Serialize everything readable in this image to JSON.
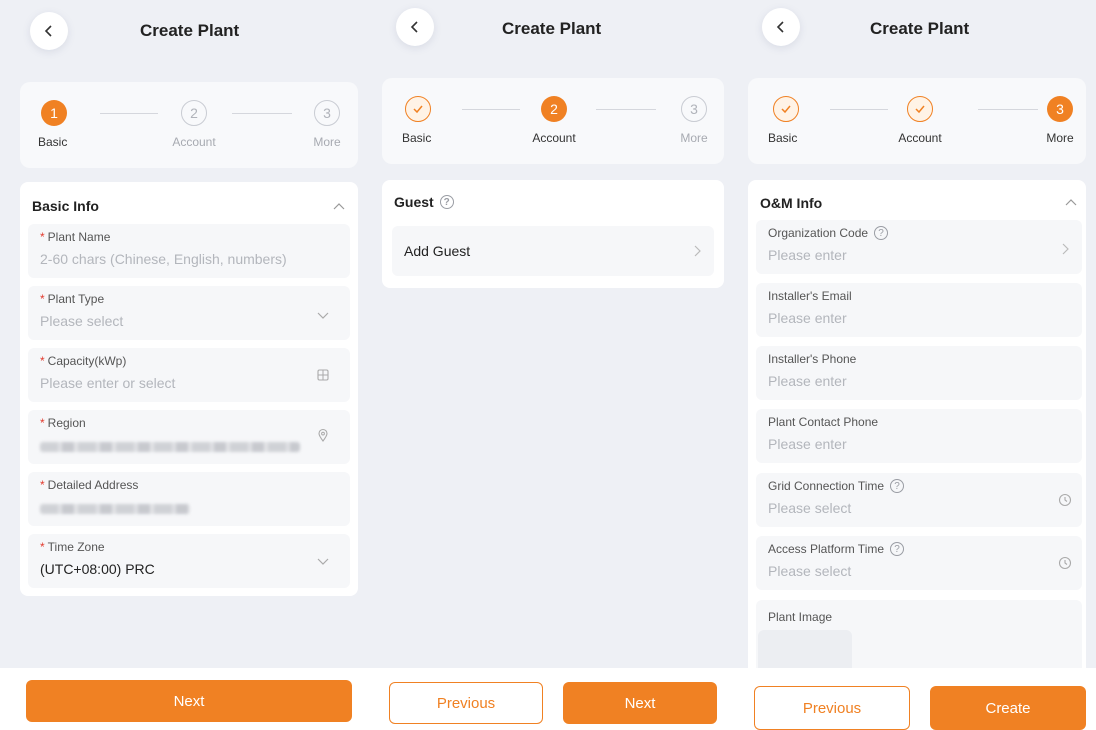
{
  "colors": {
    "accent": "#f08123",
    "background": "#eef0f5",
    "card": "#ffffff",
    "required": "#e23b2e"
  },
  "screen1": {
    "title": "Create Plant",
    "steps": [
      {
        "num": "1",
        "label": "Basic",
        "state": "active"
      },
      {
        "num": "2",
        "label": "Account",
        "state": "pending"
      },
      {
        "num": "3",
        "label": "More",
        "state": "pending"
      }
    ],
    "section_title": "Basic Info",
    "fields": {
      "plant_name": {
        "label": "Plant Name",
        "placeholder": "2-60 chars (Chinese, English, numbers)"
      },
      "plant_type": {
        "label": "Plant Type",
        "placeholder": "Please select"
      },
      "capacity": {
        "label": "Capacity(kWp)",
        "placeholder": "Please enter or select"
      },
      "region": {
        "label": "Region"
      },
      "address": {
        "label": "Detailed Address"
      },
      "timezone": {
        "label": "Time Zone",
        "value": "(UTC+08:00) PRC"
      }
    },
    "required_mark": "*",
    "next_label": "Next"
  },
  "screen2": {
    "title": "Create Plant",
    "steps": [
      {
        "num": "",
        "label": "Basic",
        "state": "done"
      },
      {
        "num": "2",
        "label": "Account",
        "state": "active"
      },
      {
        "num": "3",
        "label": "More",
        "state": "pending"
      }
    ],
    "guest_title": "Guest",
    "add_guest_label": "Add Guest",
    "previous_label": "Previous",
    "next_label": "Next"
  },
  "screen3": {
    "title": "Create Plant",
    "steps": [
      {
        "num": "",
        "label": "Basic",
        "state": "done"
      },
      {
        "num": "",
        "label": "Account",
        "state": "done"
      },
      {
        "num": "3",
        "label": "More",
        "state": "active"
      }
    ],
    "section_title": "O&M Info",
    "fields": {
      "org_code": {
        "label": "Organization Code",
        "placeholder": "Please enter"
      },
      "installer_email": {
        "label": "Installer's Email",
        "placeholder": "Please enter"
      },
      "installer_phone": {
        "label": "Installer's Phone",
        "placeholder": "Please enter"
      },
      "contact_phone": {
        "label": "Plant Contact Phone",
        "placeholder": "Please enter"
      },
      "grid_time": {
        "label": "Grid Connection Time",
        "placeholder": "Please select"
      },
      "platform_time": {
        "label": "Access Platform Time",
        "placeholder": "Please select"
      },
      "plant_image": {
        "label": "Plant Image"
      }
    },
    "help_glyph": "?",
    "plus_glyph": "+",
    "previous_label": "Previous",
    "create_label": "Create"
  },
  "icons": {
    "back": "chevron-left-icon",
    "collapse": "chevron-up-icon",
    "dropdown": "chevron-down-icon",
    "calculator": "calculator-icon",
    "location": "location-pin-icon",
    "arrow": "chevron-right-icon",
    "clock": "clock-icon",
    "help": "help-circle-icon",
    "check": "check-icon"
  }
}
